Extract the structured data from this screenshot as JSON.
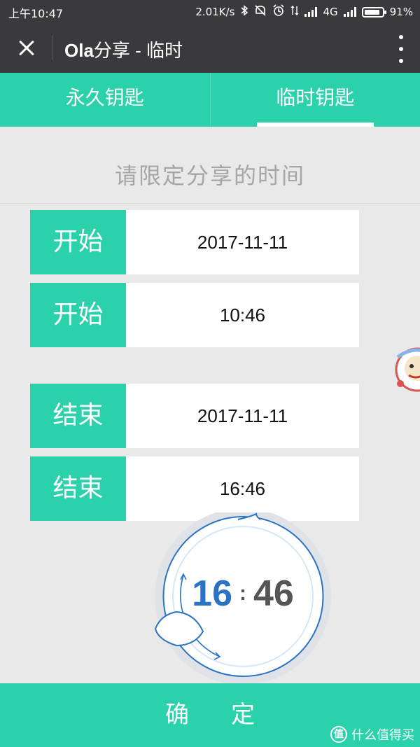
{
  "status_bar": {
    "time": "上午10:47",
    "speed": "2.01K/s",
    "network": "4G",
    "battery": "91%",
    "battery_level": 0.91,
    "icons": [
      "bluetooth-icon",
      "mute-icon",
      "alarm-icon",
      "signal-icon",
      "signal-icon",
      "battery-icon"
    ]
  },
  "title_bar": {
    "title_bold": "Ola",
    "title_rest": "分享 - 临时"
  },
  "tabs": [
    {
      "label": "永久钥匙",
      "active": false
    },
    {
      "label": "临时钥匙",
      "active": true
    }
  ],
  "prompt": "请限定分享的时间",
  "rows": [
    {
      "label": "开始",
      "value": "2017-11-11"
    },
    {
      "label": "开始",
      "value": "10:46"
    },
    {
      "label": "结束",
      "value": "2017-11-11"
    },
    {
      "label": "结束",
      "value": "16:46"
    }
  ],
  "picker": {
    "hour": "16",
    "separator": ":",
    "minute": "46"
  },
  "confirm": {
    "label": "确定"
  },
  "watermark": {
    "glyph": "值",
    "text": "什么值得买"
  },
  "colors": {
    "accent": "#2ad1ab",
    "dark_bar": "#3a3a3c",
    "background": "#e9e9e9",
    "picker_blue": "#2a73c4",
    "prompt_gray": "#a6a6a6"
  }
}
